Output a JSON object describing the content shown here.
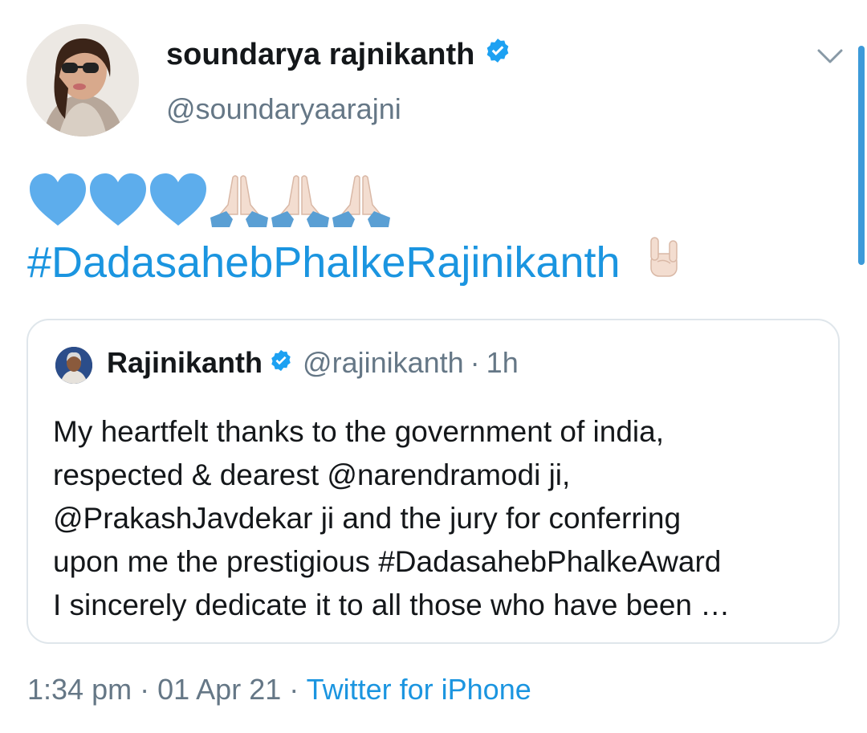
{
  "tweet": {
    "display_name": "soundarya rajnikanth",
    "handle": "@soundaryaarajni",
    "hashtag": "#DadasahebPhalkeRajinikanth",
    "emojis": [
      "blue-heart",
      "blue-heart",
      "blue-heart",
      "folded-hands",
      "folded-hands",
      "folded-hands"
    ],
    "trailing_emoji": "sign-of-the-horns"
  },
  "quoted": {
    "name": "Rajinikanth",
    "handle": "@rajinikanth",
    "separator": "·",
    "time": "1h",
    "lines": [
      "My heartfelt thanks to the government of india,",
      "respected & dearest @narendramodi ji,",
      "@PrakashJavdekar ji and the jury for conferring",
      "upon me the prestigious #DadasahebPhalkeAward",
      "I sincerely dedicate it to all those who have been …"
    ]
  },
  "footer": {
    "time": "1:34 pm",
    "separator": "·",
    "date": "01 Apr 21",
    "source": "Twitter for iPhone"
  },
  "colors": {
    "link": "#1b95e0",
    "verified": "#1da1f2",
    "secondary_text": "#657786",
    "heart": "#5dadec"
  }
}
